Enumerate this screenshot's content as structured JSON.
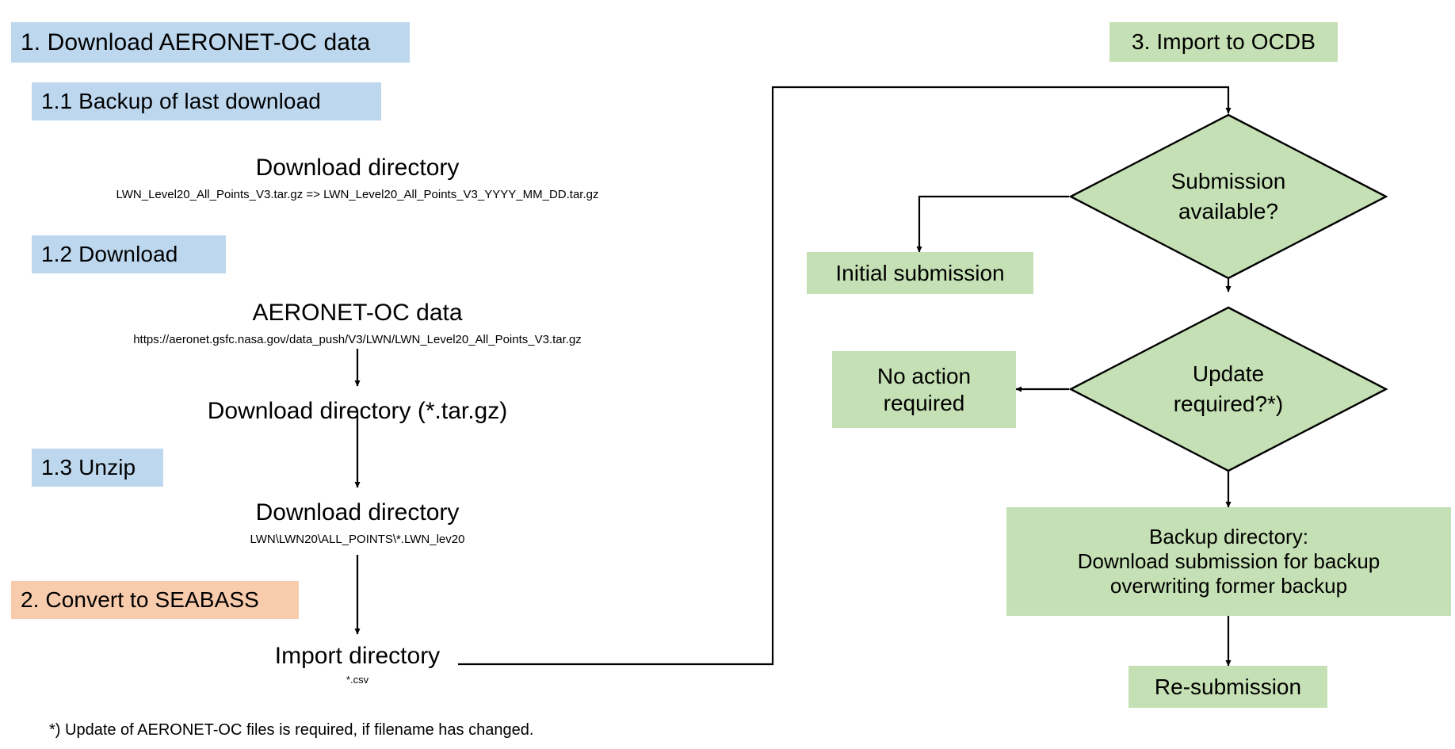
{
  "diagram": {
    "title_flow": "AERONET-OC data processing workflow",
    "colors": {
      "blue": "#bdd7ee",
      "green": "#c5e0b4",
      "orange": "#f8cbad",
      "line": "#000000",
      "text": "#000000"
    }
  },
  "left_column": {
    "step1_banner": "1. Download AERONET-OC data",
    "step11_banner": "1.1 Backup of last download",
    "backup_dir_label": "Download directory",
    "backup_dir_detail": "LWN_Level20_All_Points_V3.tar.gz => LWN_Level20_All_Points_V3_YYYY_MM_DD.tar.gz",
    "step12_banner": "1.2 Download",
    "source_label": "AERONET-OC data",
    "source_url": "https://aeronet.gsfc.nasa.gov/data_push/V3/LWN/LWN_Level20_All_Points_V3.tar.gz",
    "download_dir_targz": "Download directory (*.tar.gz)",
    "step13_banner": "1.3 Unzip",
    "unzip_dir_label": "Download directory",
    "unzip_dir_detail": "LWN\\LWN20\\ALL_POINTS\\*.LWN_lev20",
    "step2_banner": "2. Convert to SEABASS",
    "import_dir_label": "Import directory",
    "import_dir_detail": "*.csv"
  },
  "right_column": {
    "step3_banner": "3. Import to OCDB",
    "decision_submission": "Submission\navailable?",
    "initial_submission": "Initial submission",
    "decision_update": "Update\nrequired?*)",
    "no_action": "No action\nrequired",
    "backup_directory": "Backup directory:\nDownload submission for backup\noverwriting former backup",
    "resubmission": "Re-submission"
  },
  "footnote": {
    "text": "*) Update of AERONET-OC files is required, if filename has changed."
  }
}
